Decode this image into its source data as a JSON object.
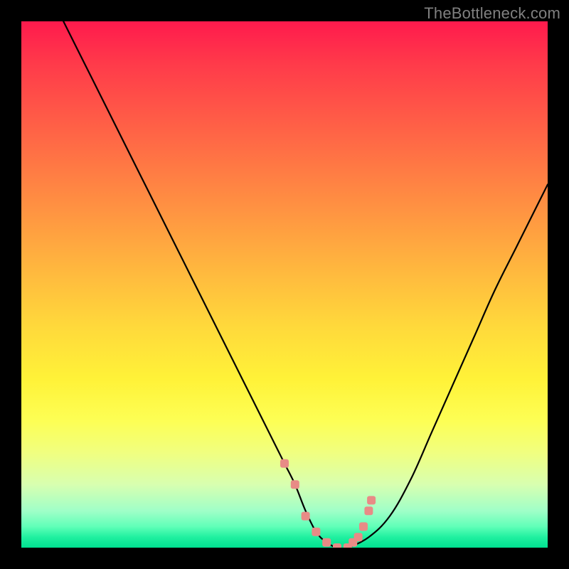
{
  "watermark": "TheBottleneck.com",
  "colors": {
    "frame": "#000000",
    "curve": "#000000",
    "marker": "#e88b86",
    "gradient_top": "#ff1a4d",
    "gradient_mid": "#fff238",
    "gradient_bottom": "#00e090"
  },
  "chart_data": {
    "type": "line",
    "title": "",
    "xlabel": "",
    "ylabel": "",
    "xlim": [
      0,
      100
    ],
    "ylim": [
      0,
      100
    ],
    "grid": false,
    "legend": false,
    "series": [
      {
        "name": "curve",
        "x": [
          8,
          12,
          16,
          20,
          24,
          28,
          32,
          36,
          40,
          44,
          48,
          50,
          52,
          54,
          56,
          58,
          60,
          62,
          66,
          70,
          74,
          78,
          82,
          86,
          90,
          94,
          98,
          100
        ],
        "y": [
          100,
          92,
          84,
          76,
          68,
          60,
          52,
          44,
          36,
          28,
          20,
          16,
          12,
          7,
          3,
          1,
          0,
          0,
          2,
          6,
          13,
          22,
          31,
          40,
          49,
          57,
          65,
          69
        ]
      }
    ],
    "markers": {
      "name": "highlighted-points",
      "x": [
        50,
        52,
        54,
        56,
        58,
        60,
        62,
        63,
        64,
        65,
        66,
        66.5
      ],
      "y": [
        16,
        12,
        6,
        3,
        1,
        0,
        0,
        1,
        2,
        4,
        7,
        9
      ]
    },
    "annotations": [
      {
        "text": "TheBottleneck.com",
        "position": "top-right"
      }
    ]
  }
}
